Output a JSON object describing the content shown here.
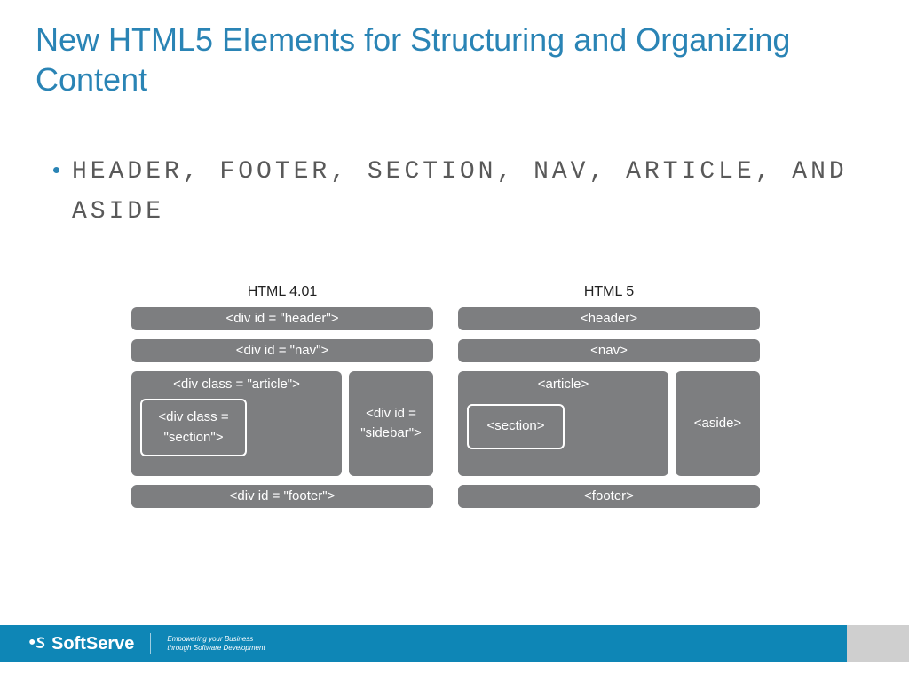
{
  "title": "New HTML5 Elements for Structuring and Organizing Content",
  "bullet": "Header, Footer, Section, Nav, Article, and Aside",
  "diagram": {
    "left": {
      "title": "HTML 4.01",
      "header": "<div id = \"header\">",
      "nav": "<div id = \"nav\">",
      "article": "<div class = \"article\">",
      "section": "<div class = \"section\">",
      "sidebar": "<div id = \"sidebar\">",
      "footer": "<div id = \"footer\">"
    },
    "right": {
      "title": "HTML 5",
      "header": "<header>",
      "nav": "<nav>",
      "article": "<article>",
      "section": "<section>",
      "aside": "<aside>",
      "footer": "<footer>"
    }
  },
  "brand": {
    "name": "SoftServe",
    "tag1": "Empowering your Business",
    "tag2": "through Software Development"
  }
}
